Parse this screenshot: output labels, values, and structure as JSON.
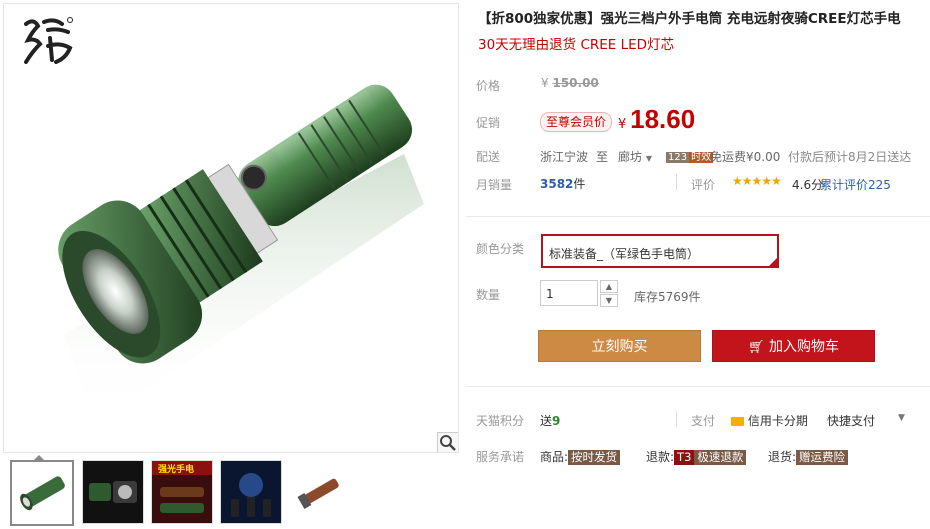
{
  "product": {
    "title": "【折800独家优惠】强光三档户外手电筒 充电远射夜骑CREE灯芯手电",
    "subtitle": "30天无理由退货 CREE LED灯芯"
  },
  "price": {
    "label": "价格",
    "currency": "¥",
    "original": "150.00",
    "promo_label": "促销",
    "vip_badge": "至尊会员价",
    "promo": "18.60"
  },
  "shipping": {
    "label": "配送",
    "from": "浙江宁波",
    "to_word": "至",
    "to": "廊坊",
    "badge": "123",
    "badge_suffix": "时效",
    "fee": "免运费¥0.00",
    "eta": "付款后预计8月2日送达"
  },
  "sales": {
    "label": "月销量",
    "count": "3582",
    "unit": "件",
    "review_label": "评价",
    "rating": "4.6分",
    "review_link": "累计评价225",
    "stars": 4.6
  },
  "options": {
    "color_label": "颜色分类",
    "color_value": "标准装备_（军绿色手电筒）",
    "qty_label": "数量",
    "qty_value": "1",
    "stock": "库存5769件"
  },
  "actions": {
    "buy": "立刻购买",
    "cart": "加入购物车"
  },
  "points": {
    "label": "天猫积分",
    "value_prefix": "送",
    "value": "9",
    "pay_label": "支付",
    "credit": "信用卡分期",
    "quick_pay": "快捷支付"
  },
  "service": {
    "label": "服务承诺",
    "goods_label": "商品:",
    "goods_tag": "按时发货",
    "refund_label": "退款:",
    "refund_tag_a": "T3",
    "refund_tag_b": "极速退款",
    "return_label": "退货:",
    "return_tag": "赠运费险"
  },
  "thumb_text": {
    "t3": "强光手电"
  },
  "colors": {
    "price_red": "#c40000",
    "buy_orange": "#cd8a44",
    "cart_red": "#c4141b",
    "flashlight_green": "#3a6b3a"
  }
}
